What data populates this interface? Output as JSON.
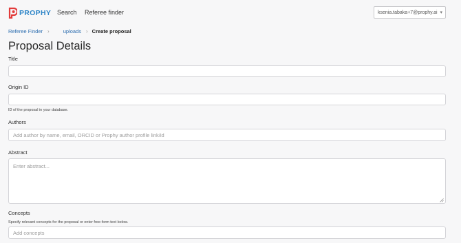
{
  "brand": {
    "name": "PROPHY",
    "color": "#2f86c8",
    "icon": "prophy-logo-icon"
  },
  "nav": {
    "search": "Search",
    "referee_finder": "Referee finder"
  },
  "user": {
    "email": "ksenia.tabaka+7@prophy.ai"
  },
  "breadcrumb": {
    "items": [
      "Referee Finder",
      "uploads",
      "Create proposal"
    ]
  },
  "page": {
    "title": "Proposal Details"
  },
  "form": {
    "title_label": "Title",
    "title_value": "",
    "origin_label": "Origin ID",
    "origin_value": "",
    "origin_help": "ID of the proposal in your database.",
    "authors_label": "Authors",
    "authors_placeholder": "Add author by name, email, ORCID or Prophy author profile link/id",
    "abstract_label": "Abstract",
    "abstract_placeholder": "Enter abstract...",
    "concepts_label": "Concepts",
    "concepts_help": "Specify relevant concepts for the proposal or enter free-form text below.",
    "concepts_placeholder": "Add concepts"
  }
}
